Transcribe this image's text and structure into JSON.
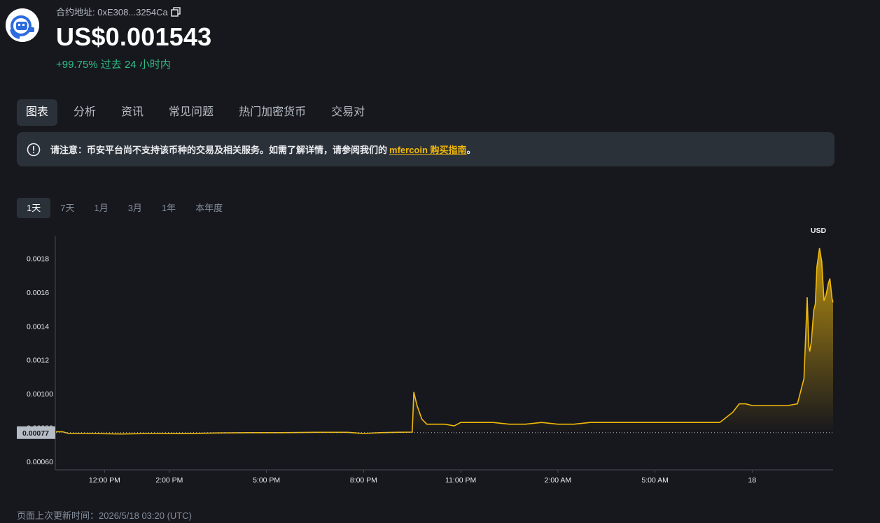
{
  "header": {
    "contract_label": "合约地址: 0xE308...3254Ca",
    "price": "US$0.001543",
    "change": "+99.75% 过去 24 小时内"
  },
  "tabs": [
    {
      "label": "图表",
      "active": true
    },
    {
      "label": "分析",
      "active": false
    },
    {
      "label": "资讯",
      "active": false
    },
    {
      "label": "常见问题",
      "active": false
    },
    {
      "label": "热门加密货币",
      "active": false
    },
    {
      "label": "交易对",
      "active": false
    }
  ],
  "notice": {
    "text": "请注意：币安平台尚不支持该币种的交易及相关服务。如需了解详情，请参阅我们的",
    "link": "mfercoin 购买指南",
    "suffix": "。"
  },
  "ranges": [
    {
      "label": "1天",
      "active": true
    },
    {
      "label": "7天",
      "active": false
    },
    {
      "label": "1月",
      "active": false
    },
    {
      "label": "3月",
      "active": false
    },
    {
      "label": "1年",
      "active": false
    },
    {
      "label": "本年度",
      "active": false
    }
  ],
  "footer": {
    "updated": "页面上次更新时间：2026/5/18 03:20 (UTC)"
  },
  "colors": {
    "line": "#f0b90b",
    "positive": "#2ebd85",
    "background": "#17181d",
    "panel": "#2b3139"
  },
  "chart_data": {
    "type": "area",
    "currency_label": "USD",
    "y_ticks": [
      "0.00060",
      "0.00080",
      "0.00100",
      "0.0012",
      "0.0014",
      "0.0016",
      "0.0018"
    ],
    "y_tick_values": [
      0.0006,
      0.0008,
      0.001,
      0.0012,
      0.0014,
      0.0016,
      0.0018
    ],
    "ylim": [
      0.00055,
      0.00193
    ],
    "x_ticks": [
      "12:00 PM",
      "2:00 PM",
      "5:00 PM",
      "8:00 PM",
      "11:00 PM",
      "2:00 AM",
      "5:00 AM",
      "18"
    ],
    "x_tick_hours": [
      1.5,
      3.5,
      6.5,
      9.5,
      12.5,
      15.5,
      18.5,
      21.5
    ],
    "xlim": [
      0,
      24
    ],
    "reference_value": 0.00077,
    "reference_label": "0.00077",
    "x": [
      0,
      0.2,
      0.4,
      1.0,
      2.0,
      3.0,
      4.0,
      5.0,
      6.0,
      7.0,
      8.0,
      9.0,
      9.5,
      10.0,
      10.5,
      11.0,
      11.02,
      11.05,
      11.15,
      11.3,
      11.45,
      11.6,
      12.0,
      12.3,
      12.5,
      13.0,
      13.5,
      14.0,
      14.5,
      15.0,
      15.5,
      16.0,
      16.5,
      17.0,
      17.5,
      18.0,
      18.5,
      19.0,
      19.5,
      20.0,
      20.5,
      20.9,
      21.1,
      21.3,
      21.5,
      21.7,
      22.0,
      22.3,
      22.6,
      22.9,
      23.1,
      23.2,
      23.25,
      23.28,
      23.33,
      23.4,
      23.45,
      23.5,
      23.58,
      23.65,
      23.72,
      23.78,
      23.85,
      23.9,
      23.97,
      24.0
    ],
    "y": [
      0.000775,
      0.000775,
      0.000765,
      0.000765,
      0.000762,
      0.000765,
      0.000764,
      0.000768,
      0.00077,
      0.00077,
      0.000772,
      0.000772,
      0.000765,
      0.00077,
      0.000772,
      0.000773,
      0.00086,
      0.00101,
      0.00093,
      0.00085,
      0.00082,
      0.00082,
      0.00082,
      0.00081,
      0.00083,
      0.00083,
      0.00083,
      0.00082,
      0.00082,
      0.00083,
      0.00082,
      0.00082,
      0.00083,
      0.00083,
      0.00083,
      0.00083,
      0.00083,
      0.00083,
      0.00083,
      0.00083,
      0.00083,
      0.00089,
      0.00094,
      0.00094,
      0.00093,
      0.00093,
      0.00093,
      0.00093,
      0.00093,
      0.00094,
      0.00109,
      0.00157,
      0.00128,
      0.00125,
      0.00131,
      0.00149,
      0.00153,
      0.00175,
      0.00186,
      0.00178,
      0.00155,
      0.00158,
      0.00165,
      0.00168,
      0.00156,
      0.00154
    ]
  }
}
